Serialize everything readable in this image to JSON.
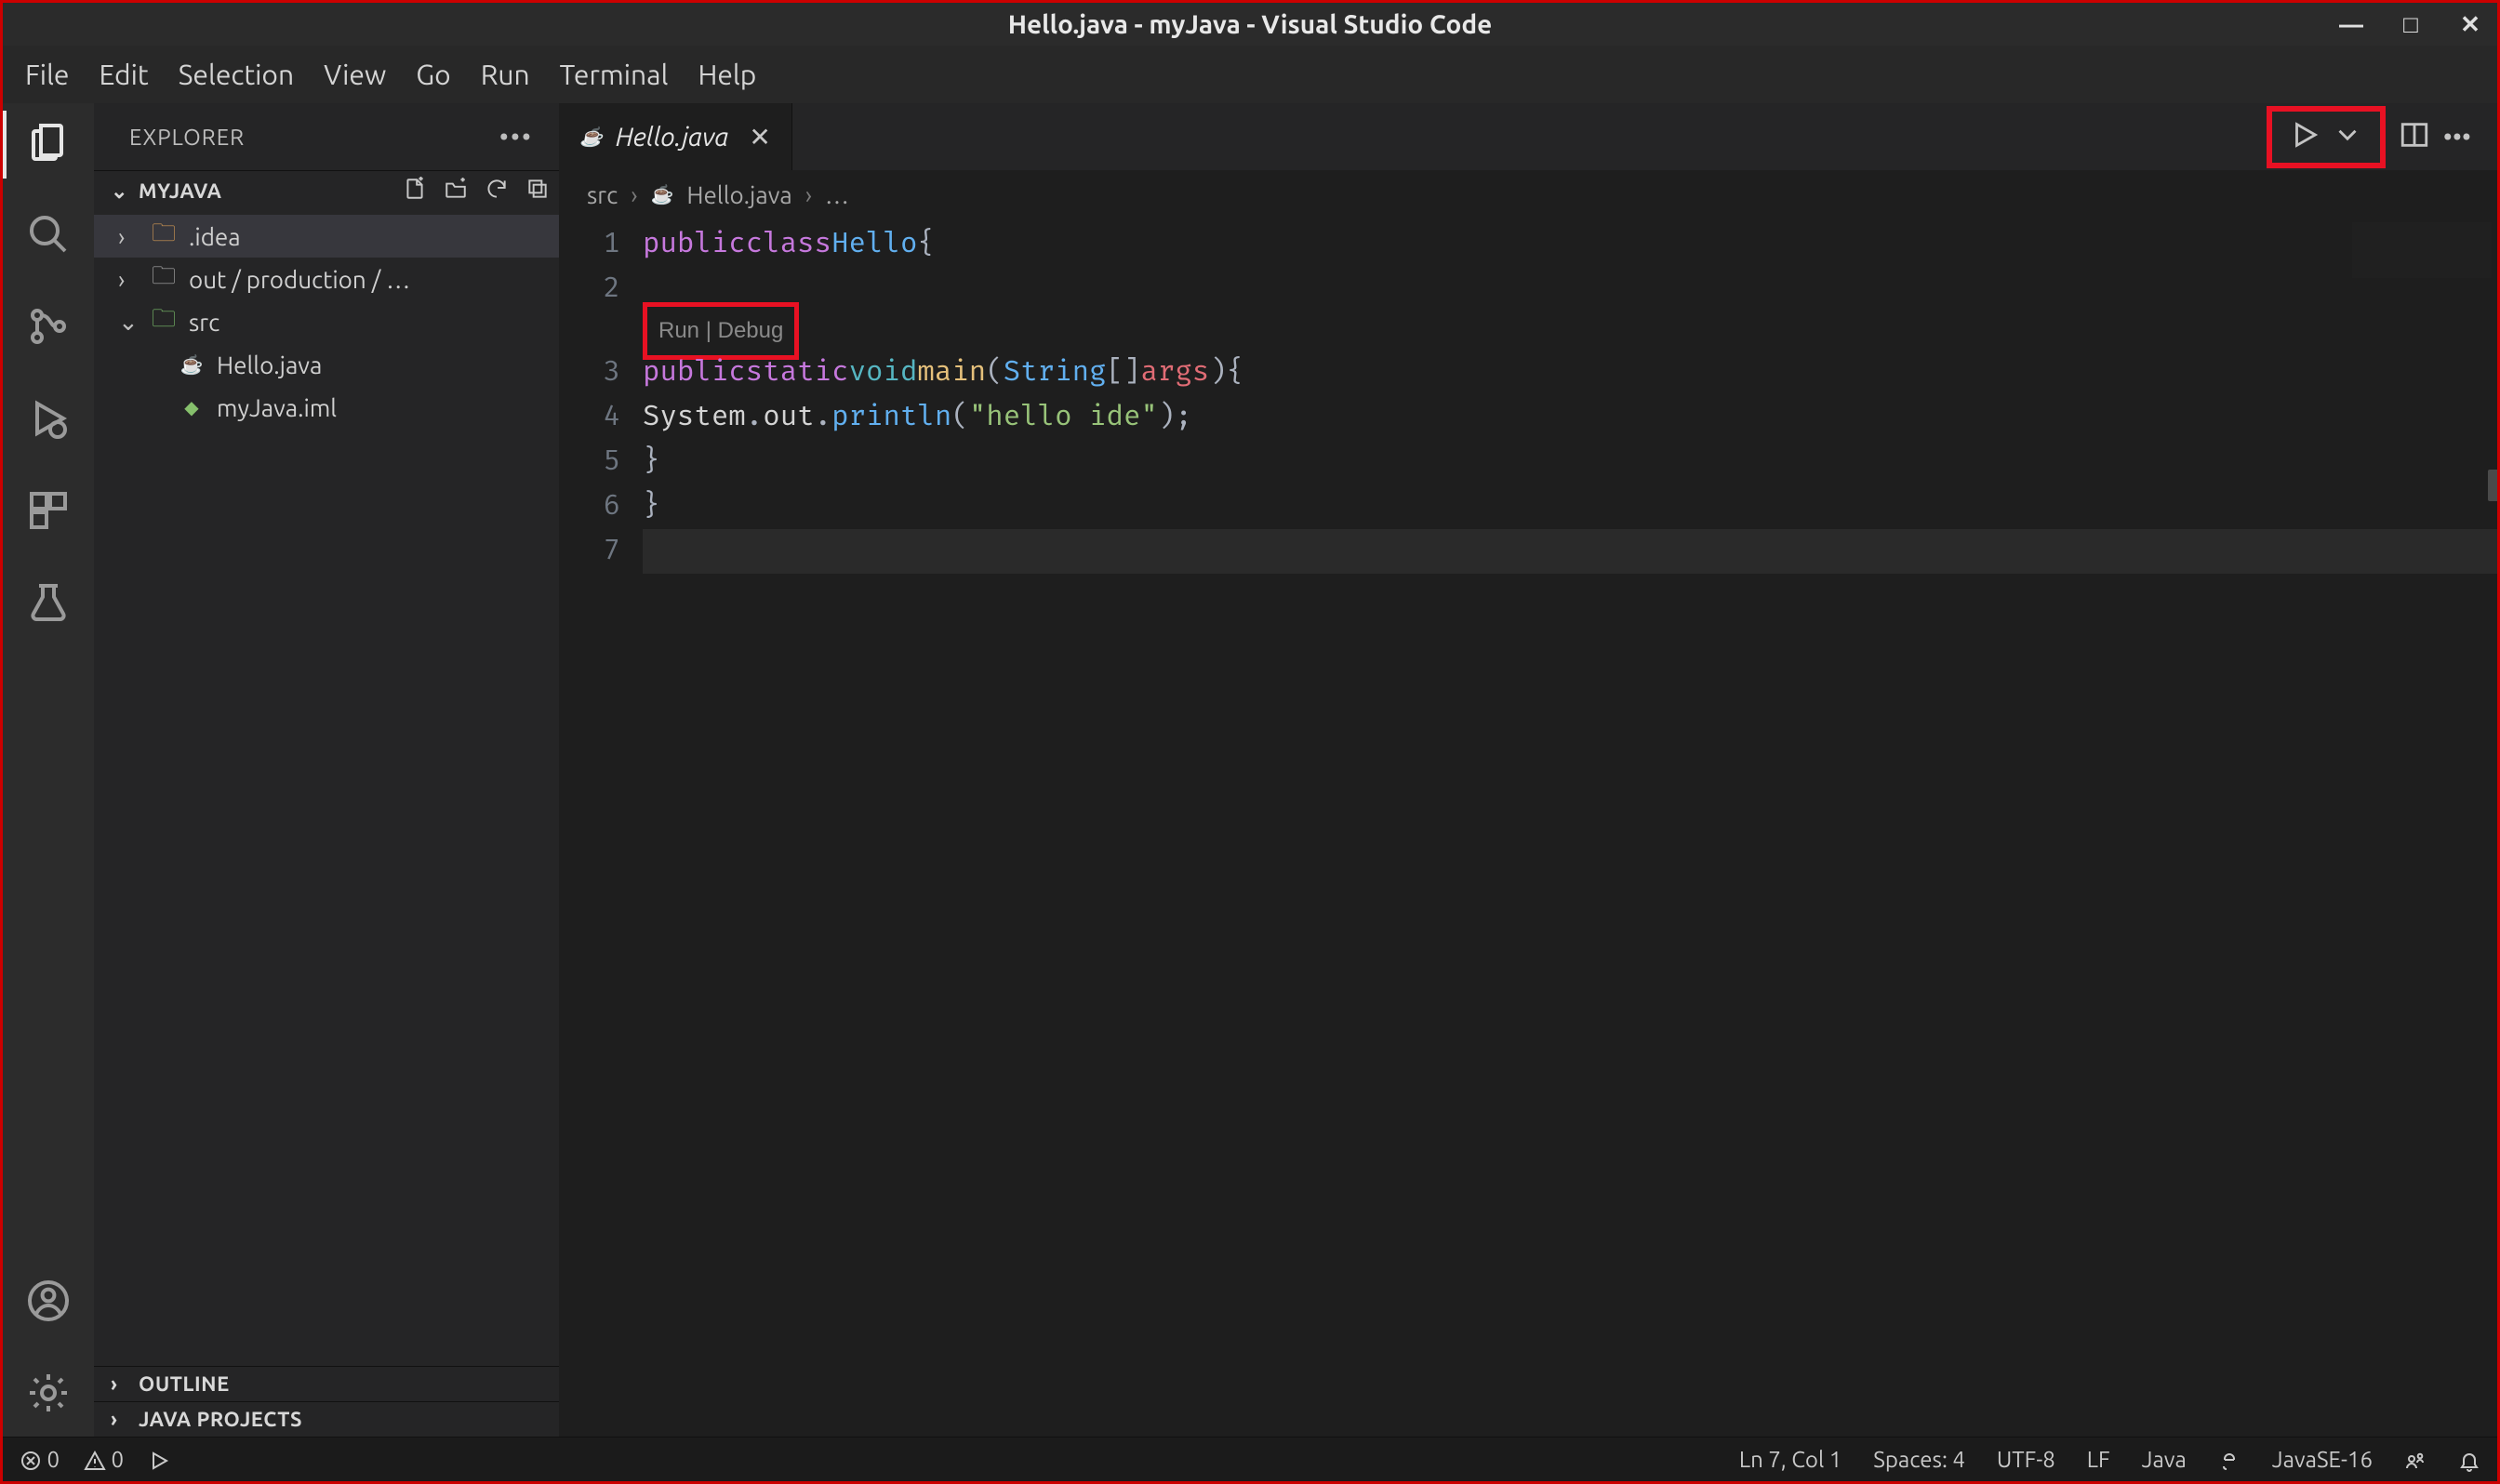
{
  "title": "Hello.java - myJava - Visual Studio Code",
  "menu": [
    "File",
    "Edit",
    "Selection",
    "View",
    "Go",
    "Run",
    "Terminal",
    "Help"
  ],
  "sidebar": {
    "title": "EXPLORER",
    "section": "MYJAVA",
    "tree": [
      {
        "kind": "folder",
        "open": false,
        "depth": 0,
        "label": ".idea",
        "selected": true,
        "iconColor": "color"
      },
      {
        "kind": "folder",
        "open": false,
        "depth": 0,
        "label": "out / production / …",
        "iconColor": "grey"
      },
      {
        "kind": "folder",
        "open": true,
        "depth": 0,
        "label": "src",
        "iconColor": "open"
      },
      {
        "kind": "file",
        "depth": 1,
        "label": "Hello.java",
        "fileType": "java"
      },
      {
        "kind": "file",
        "depth": 1,
        "label": "myJava.iml",
        "fileType": "iml"
      }
    ],
    "bottom": [
      "OUTLINE",
      "JAVA PROJECTS"
    ]
  },
  "tab": {
    "label": "Hello.java",
    "icon": "java"
  },
  "breadcrumbs": {
    "a": "src",
    "b": "Hello.java",
    "c": "…"
  },
  "codelens": {
    "run": "Run",
    "debug": "Debug"
  },
  "code": {
    "lines": [
      {
        "n": 1,
        "indent": 0,
        "html": "<span class='tok-kw'>public</span> <span class='tok-kw'>class</span> <span class='tok-cls'>Hello</span> <span class='tok-punc'>{</span>"
      },
      {
        "n": 2,
        "indent": 0,
        "html": ""
      },
      {
        "n": 3,
        "indent": 1,
        "html": "<span class='tok-kw'>public</span> <span class='tok-kw'>static</span> <span class='tok-type'>void</span> <span class='tok-fn'>main</span><span class='tok-punc'>(</span><span class='tok-cls'>String</span><span class='tok-punc'>[]</span> <span class='tok-var'>args</span><span class='tok-punc'>)</span> <span class='tok-punc'>{</span>"
      },
      {
        "n": 4,
        "indent": 2,
        "html": "<span class='tok-plain'>System</span><span class='tok-punc'>.</span><span class='tok-plain'>out</span><span class='tok-punc'>.</span><span class='tok-call'>println</span><span class='tok-punc'>(</span><span class='tok-str'>\"hello ide\"</span><span class='tok-punc'>);</span>"
      },
      {
        "n": 5,
        "indent": 1,
        "html": "<span class='tok-punc'>}</span>"
      },
      {
        "n": 6,
        "indent": 0,
        "html": "<span class='tok-punc'>}</span>"
      },
      {
        "n": 7,
        "indent": 0,
        "html": "",
        "current": true
      }
    ]
  },
  "status": {
    "errors": "0",
    "warnings": "0",
    "pos": "Ln 7, Col 1",
    "spaces": "Spaces: 4",
    "enc": "UTF-8",
    "eol": "LF",
    "lang": "Java",
    "jdk": "JavaSE-16"
  }
}
